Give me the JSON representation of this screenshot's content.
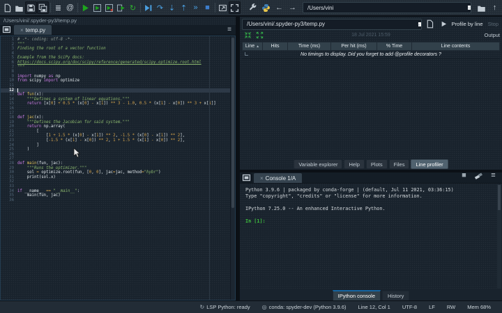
{
  "toolbar": {
    "path_value": "/Users/vini",
    "main_icons": [
      {
        "name": "new-file-icon",
        "kind": "doc"
      },
      {
        "name": "open-file-icon",
        "kind": "folder"
      },
      {
        "name": "save-icon",
        "kind": "save",
        "pressed": true
      },
      {
        "name": "save-all-icon",
        "kind": "saveall",
        "pressed": true
      },
      {
        "sep": true
      },
      {
        "name": "file-switcher-icon",
        "kind": "lines"
      },
      {
        "name": "find-symbols-icon",
        "kind": "at"
      },
      {
        "sep": true
      },
      {
        "name": "run-file-icon",
        "kind": "play",
        "color": "#1ea51e"
      },
      {
        "name": "run-cell-icon",
        "kind": "playbox",
        "color": "#1ea51e"
      },
      {
        "name": "run-cell-advance-icon",
        "kind": "playboxadv",
        "color": "#1ea51e"
      },
      {
        "name": "run-selection-icon",
        "kind": "runsel",
        "color": "#1ea51e"
      },
      {
        "name": "rerun-cell-icon",
        "kind": "replay",
        "color": "#2fae2f"
      },
      {
        "sep": true
      },
      {
        "name": "debug-file-icon",
        "kind": "debugplay",
        "color": "#4a9fe0"
      },
      {
        "name": "step-over-icon",
        "kind": "stepover",
        "color": "#4a9fe0"
      },
      {
        "name": "step-into-icon",
        "kind": "stepinto",
        "color": "#4a9fe0"
      },
      {
        "name": "step-return-icon",
        "kind": "stepout",
        "color": "#4a9fe0"
      },
      {
        "name": "continue-icon",
        "kind": "continue",
        "color": "#4a9fe0"
      },
      {
        "name": "stop-debug-icon",
        "kind": "stop",
        "color": "#3d7ecc"
      },
      {
        "sep": true
      },
      {
        "name": "new-window-icon",
        "kind": "window"
      },
      {
        "name": "maximize-pane-icon",
        "kind": "maximize",
        "pressed": true
      }
    ]
  },
  "editor": {
    "breadcrumb": "/Users/vini/.spyder-py3/temp.py",
    "tab_label": "temp.py",
    "current_line": 12,
    "code_lines": [
      "# -*- coding: utf-8 -*-",
      "\"\"\"",
      "Finding the root of a vector function",
      "",
      "Example from the SciPy docs:",
      "https://docs.scipy.org/doc/scipy/reference/generated/scipy.optimize.root.html",
      "\"\"\"",
      "",
      "import numpy as np",
      "from scipy import optimize",
      "",
      "",
      "def fun(x):",
      "    \"\"\"Defines a system of linear equations.\"\"\"",
      "    return [x[0] + 0.5 * (x[0] - x[1]) ** 3 - 1.0, 0.5 * (x[1] - x[0]) ** 3 + x[1]]",
      "",
      "",
      "def jac(x):",
      "    \"\"\"Defines the Jacobian for said system.\"\"\"",
      "    return np.array(",
      "        [",
      "            [1 + 1.5 * (x[0] - x[1]) ** 2, -1.5 * (x[0] - x[1]) ** 2],",
      "            [-1.5 * (x[1] - x[0]) ** 2, 1 + 1.5 * (x[1] - x[0]) ** 2],",
      "        ]",
      "    )",
      "",
      "",
      "def main(fun, jac):",
      "    \"\"\"Runs the optimizer.\"\"\"",
      "    sol = optimize.root(fun, [0, 0], jac=jac, method=\"hybr\")",
      "    print(sol.x)",
      "",
      "",
      "if __name__ == \"__main__\":",
      "    main(fun, jac)",
      ""
    ]
  },
  "profiler": {
    "file_path": "/Users/vini/.spyder-py3/temp.py",
    "profile_button": "Profile by line",
    "stop_button": "Stop",
    "timestamp": "18 Jul 2021 15:59",
    "output_label": "Output",
    "table_headers": [
      "Line",
      "Hits",
      "Time (ms)",
      "Per hit (ms)",
      "% Time",
      "Line contents"
    ],
    "empty_message": "No timings to display. Did you forget to add @profile decorators ?"
  },
  "panel_tabs": [
    {
      "label": "Variable explorer",
      "active": false
    },
    {
      "label": "Help",
      "active": false
    },
    {
      "label": "Plots",
      "active": false
    },
    {
      "label": "Files",
      "active": false
    },
    {
      "label": "Line profiler",
      "active": true
    }
  ],
  "console": {
    "tab_label": "Console 1/A",
    "lines": [
      "Python 3.9.6 | packaged by conda-forge | (default, Jul 11 2021, 03:36:15)",
      "Type \"copyright\", \"credits\" or \"license\" for more information.",
      "",
      "IPython 7.25.0 -- An enhanced Interactive Python.",
      ""
    ],
    "prompt": "In [1]:"
  },
  "bottom_tabs": [
    {
      "label": "IPython console",
      "active": true
    },
    {
      "label": "History",
      "active": false
    }
  ],
  "statusbar": {
    "items": [
      {
        "name": "lsp-status",
        "icon": "sync",
        "label": "LSP Python: ready",
        "inter": false
      },
      {
        "name": "interpreter-status",
        "icon": "env",
        "label": "conda: spyder-dev (Python 3.9.6)",
        "inter": true
      },
      {
        "name": "cursor-position-status",
        "label": "Line 12, Col 1",
        "inter": false
      },
      {
        "name": "encoding-status",
        "label": "UTF-8",
        "inter": false
      },
      {
        "name": "eol-status",
        "label": "LF",
        "inter": false
      },
      {
        "name": "readwrite-status",
        "label": "RW",
        "inter": false
      },
      {
        "name": "memory-status",
        "label": "Mem 68%",
        "inter": false
      }
    ]
  },
  "colors": {
    "panel_bg": "#19232d",
    "toolbar_bg": "#232d37",
    "accent_blue": "#1464A0",
    "run_green": "#1ea51e",
    "debug_blue": "#4a9fe0",
    "prompt_green": "#3fc13f"
  }
}
